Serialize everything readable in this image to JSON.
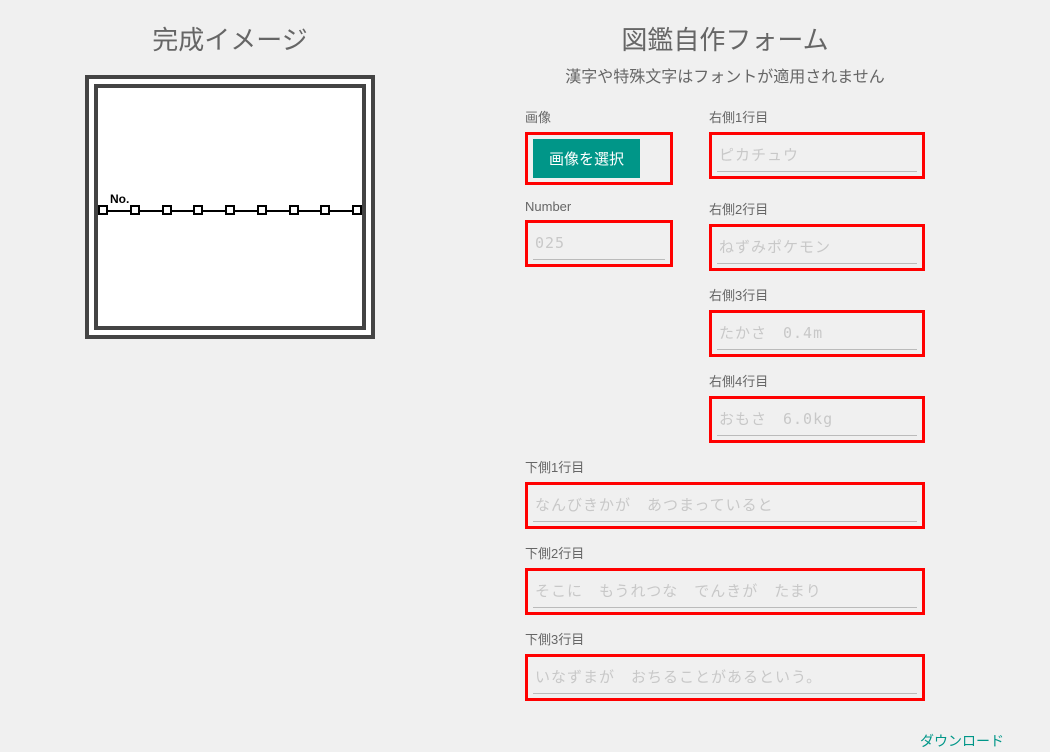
{
  "left": {
    "title": "完成イメージ",
    "no_label": "No."
  },
  "right": {
    "title": "図鑑自作フォーム",
    "subtitle": "漢字や特殊文字はフォントが適用されません"
  },
  "form": {
    "image": {
      "label": "画像",
      "button": "画像を選択"
    },
    "r1": {
      "label": "右側1行目",
      "placeholder": "ピカチュウ"
    },
    "number": {
      "label": "Number",
      "placeholder": "025"
    },
    "r2": {
      "label": "右側2行目",
      "placeholder": "ねずみポケモン"
    },
    "r3": {
      "label": "右側3行目",
      "placeholder": "たかさ　0.4m"
    },
    "r4": {
      "label": "右側4行目",
      "placeholder": "おもさ　6.0kg"
    },
    "b1": {
      "label": "下側1行目",
      "placeholder": "なんびきかが　あつまっていると"
    },
    "b2": {
      "label": "下側2行目",
      "placeholder": "そこに　もうれつな　でんきが　たまり"
    },
    "b3": {
      "label": "下側3行目",
      "placeholder": "いなずまが　おちることがあるという。"
    }
  },
  "download": "ダウンロード"
}
